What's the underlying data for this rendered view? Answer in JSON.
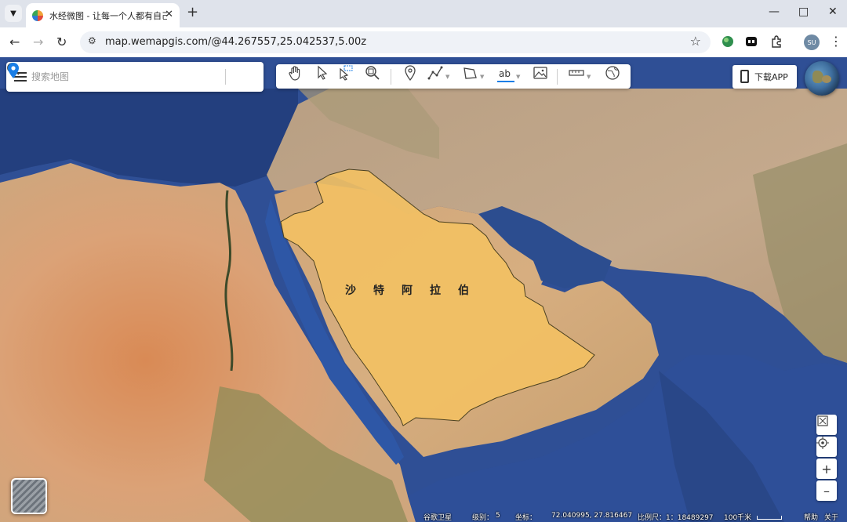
{
  "browser": {
    "tab_title": "水经微图 - 让每一个人都有自己",
    "url": "map.wemapgis.com/@44.267557,25.042537,5.00z",
    "profile_initials": "SU"
  },
  "search": {
    "placeholder": "搜索地图"
  },
  "toolbar": {
    "label_tool_text": "ab"
  },
  "download_label": "下载APP",
  "map": {
    "region_label": "沙特阿拉伯",
    "highlight_color": "#f2c063",
    "outline_color": "#4a4020"
  },
  "status": {
    "source": "谷歌卫星",
    "zoom_label": "级别：",
    "zoom_value": "5",
    "coord_label": "坐标：",
    "coords": "72.040995, 27.816467",
    "scale_label": "比例尺：1：18489297",
    "scale_bar": "100千米",
    "help": "帮助",
    "about": "关于"
  }
}
